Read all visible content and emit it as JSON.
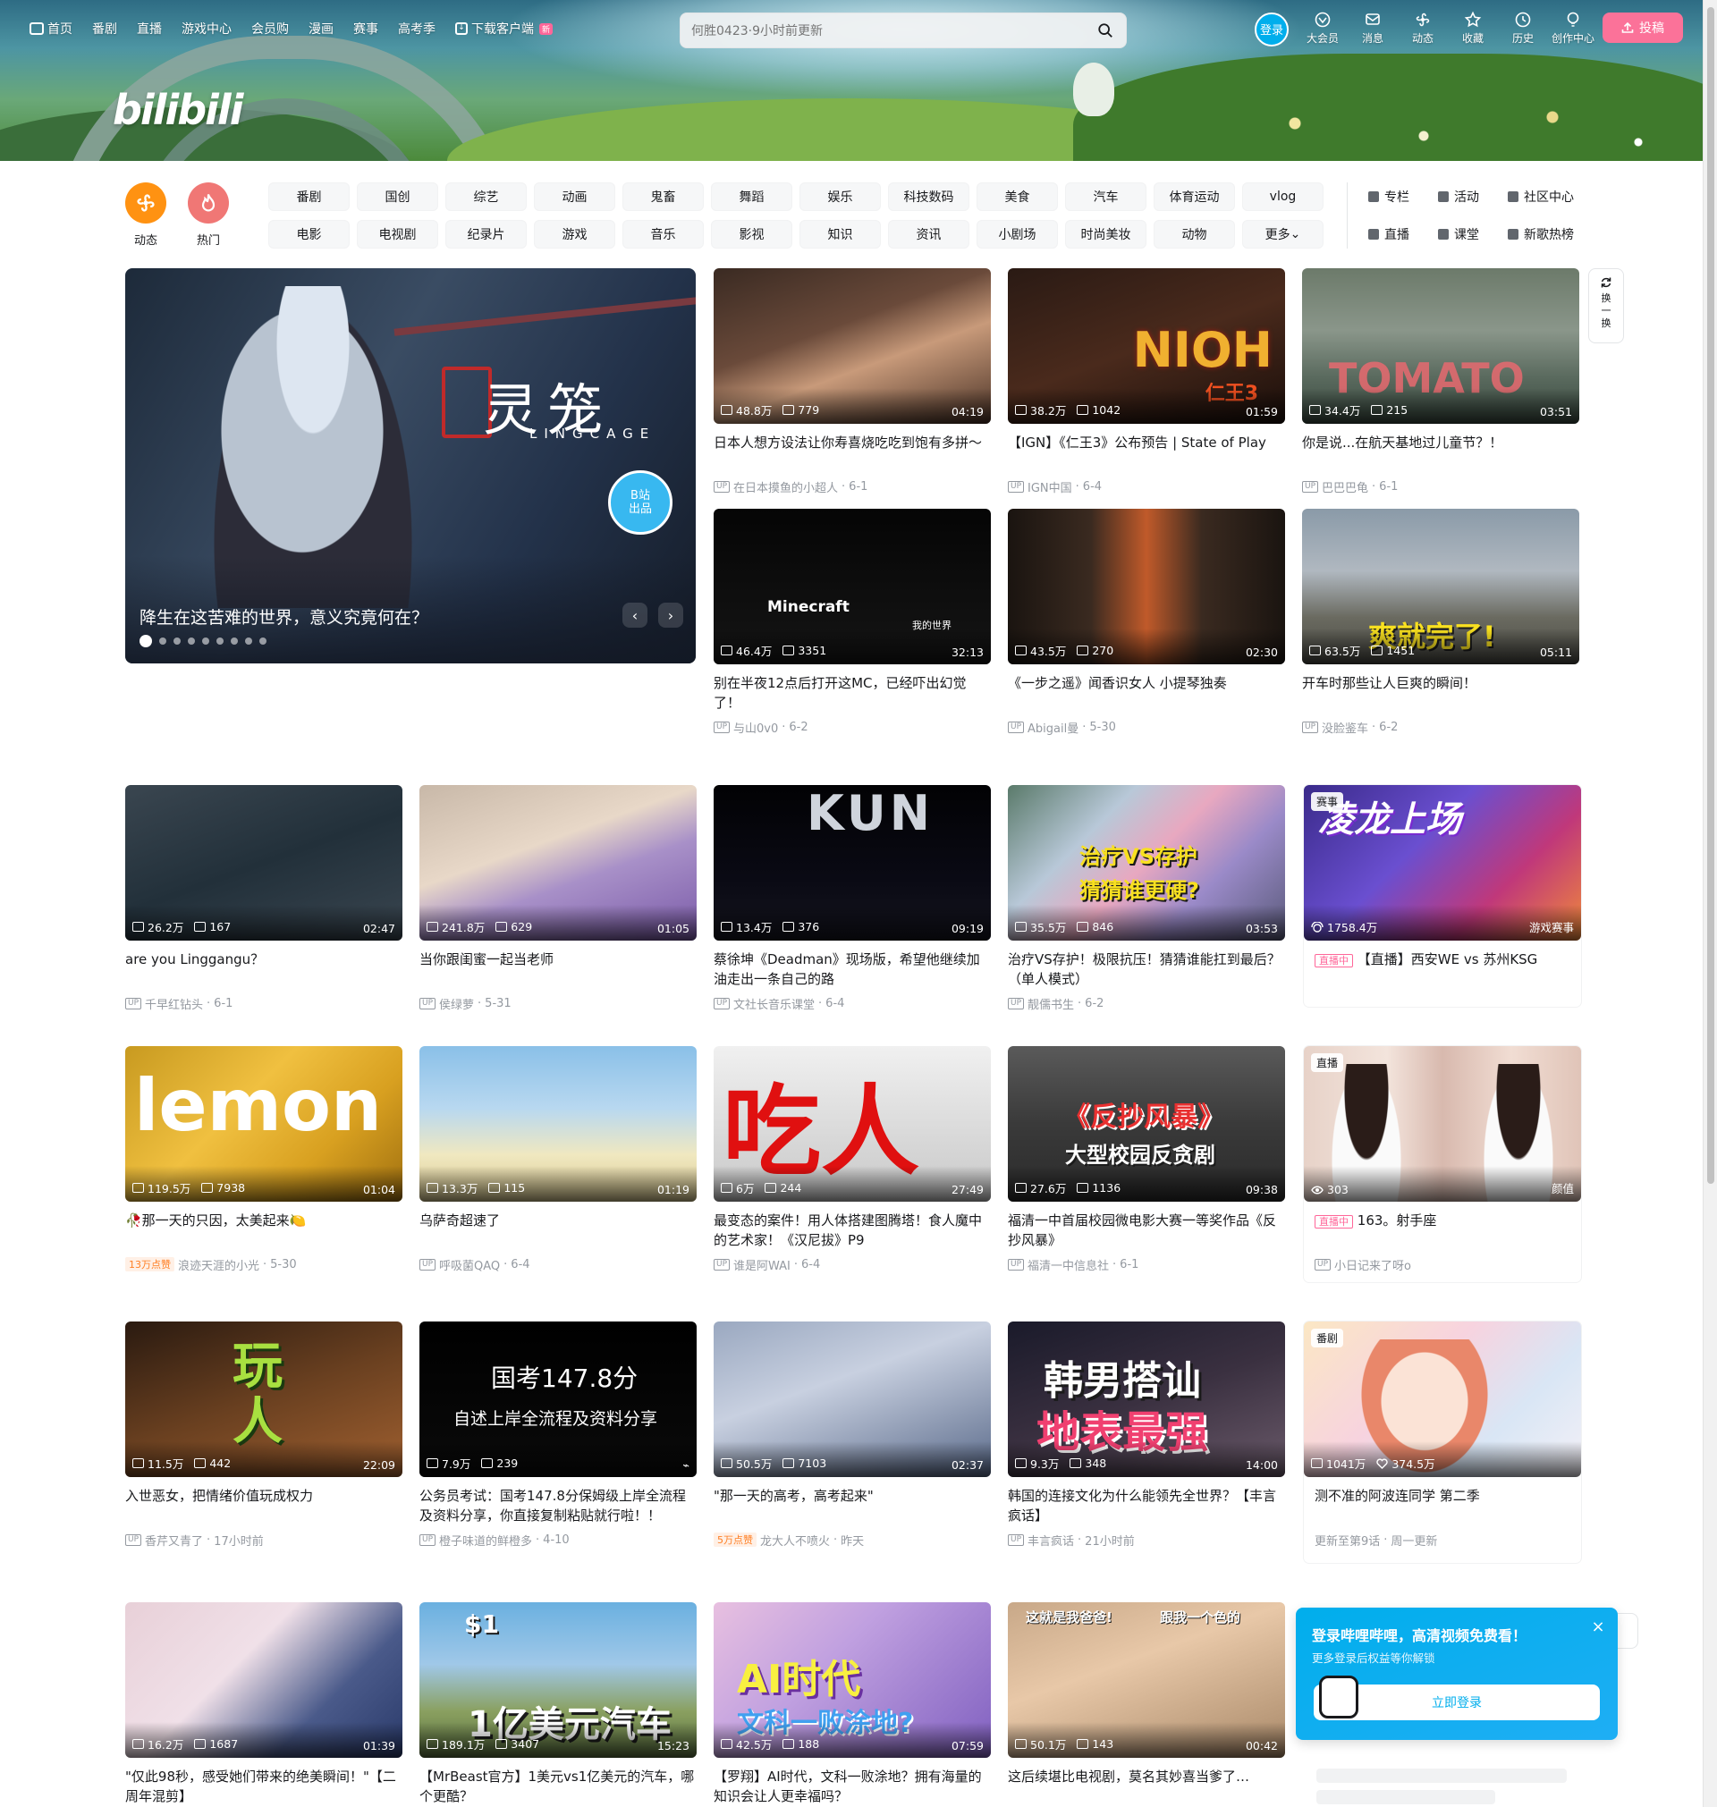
{
  "topnav": {
    "items": [
      "首页",
      "番剧",
      "直播",
      "游戏中心",
      "会员购",
      "漫画",
      "赛事",
      "高考季"
    ],
    "download": "下载客户端",
    "new_badge": "新"
  },
  "search": {
    "placeholder": "何胜0423·9小时前更新"
  },
  "user": {
    "login": "登录"
  },
  "rightnav": [
    "大会员",
    "消息",
    "动态",
    "收藏",
    "历史",
    "创作中心"
  ],
  "upload": "投稿",
  "channels": {
    "dynamic": "动态",
    "hot": "热门",
    "tags": [
      "番剧",
      "国创",
      "综艺",
      "动画",
      "鬼畜",
      "舞蹈",
      "娱乐",
      "科技数码",
      "美食",
      "汽车",
      "体育运动",
      "vlog",
      "电影",
      "电视剧",
      "纪录片",
      "游戏",
      "音乐",
      "影视",
      "知识",
      "资讯",
      "小剧场",
      "时尚美妆",
      "动物",
      "更多"
    ],
    "side": [
      "专栏",
      "活动",
      "社区中心",
      "直播",
      "课堂",
      "新歌热榜"
    ]
  },
  "carousel": {
    "title": "降生在这苦难的世界，意义究竟何在？",
    "logo_text": "灵笼",
    "logo_sub": "LINGCAGE",
    "badge_top": "B站",
    "badge_bottom": "出品",
    "prev": "‹",
    "next": "›"
  },
  "refresh": [
    "换",
    "一",
    "换"
  ],
  "cards": [
    {
      "plays": "48.8万",
      "danmaku": "779",
      "duration": "04:19",
      "title": "日本人想方设法让你寿喜烧吃吃到饱有多拼～",
      "uploader": "在日本摸鱼的小超人",
      "date": "6-1"
    },
    {
      "plays": "38.2万",
      "danmaku": "1042",
      "duration": "01:59",
      "title": "【IGN】《仁王3》公布预告 | State of Play",
      "uploader": "IGN中国",
      "date": "6-4",
      "overlay": "NIOH",
      "overlay2": "仁王3"
    },
    {
      "plays": "34.4万",
      "danmaku": "215",
      "duration": "03:51",
      "title": "你是说...在航天基地过儿童节？！",
      "uploader": "巴巴巴龟",
      "date": "6-1",
      "overlay": "TOMATO"
    },
    {
      "plays": "46.4万",
      "danmaku": "3351",
      "duration": "32:13",
      "title": "别在半夜12点后打开这MC，已经吓出幻觉了！",
      "uploader": "与山0v0",
      "date": "6-2",
      "overlay": "Minecraft",
      "overlay2": "我的世界"
    },
    {
      "plays": "43.5万",
      "danmaku": "270",
      "duration": "02:30",
      "title": "《一步之遥》闻香识女人 小提琴独奏",
      "uploader": "Abigail曼",
      "date": "5-30"
    },
    {
      "plays": "63.5万",
      "danmaku": "1451",
      "duration": "05:11",
      "title": "开车时那些让人巨爽的瞬间！",
      "uploader": "没脸鉴车",
      "date": "6-2",
      "overlay": "爽就完了!"
    },
    {
      "plays": "26.2万",
      "danmaku": "167",
      "duration": "02:47",
      "title": "are you Linggangu？",
      "uploader": "千早红钻头",
      "date": "6-1"
    },
    {
      "plays": "241.8万",
      "danmaku": "629",
      "duration": "01:05",
      "title": "当你跟闺蜜一起当老师",
      "uploader": "侯绿萝",
      "date": "5-31"
    },
    {
      "plays": "13.4万",
      "danmaku": "376",
      "duration": "09:19",
      "title": "蔡徐坤《Deadman》现场版，希望他继续加油走出一条自己的路",
      "uploader": "文社长音乐课堂",
      "date": "6-4",
      "overlay": "KUN"
    },
    {
      "plays": "35.5万",
      "danmaku": "846",
      "duration": "03:53",
      "title": "治疗VS存护！极限抗压！猜猜谁能扛到最后？（单人模式）",
      "uploader": "靓儒书生",
      "date": "6-2",
      "overlay": "治疗VS存护",
      "overlay2": "猜猜谁更硬?"
    },
    {
      "plays": "119.5万",
      "danmaku": "7938",
      "duration": "01:04",
      "title": "🥀那一天的只因，太美起来🍋",
      "uploader": "浪迹天涯的小光",
      "date": "5-30",
      "hot": "13万点赞",
      "overlay": "lemon"
    },
    {
      "plays": "13.3万",
      "danmaku": "115",
      "duration": "01:19",
      "title": "乌萨奇超速了",
      "uploader": "呼吸菌QAQ",
      "date": "6-4"
    },
    {
      "plays": "6万",
      "danmaku": "244",
      "duration": "27:49",
      "title": "最变态的案件！用人体搭建图腾塔！食人魔中的艺术家！《汉尼拔》P9",
      "uploader": "谁是阿WAI",
      "date": "6-4",
      "overlay": "吃人"
    },
    {
      "plays": "27.6万",
      "danmaku": "1136",
      "duration": "09:38",
      "title": "福清一中首届校园微电影大赛一等奖作品《反抄风暴》",
      "uploader": "福清一中信息社",
      "date": "6-1",
      "overlay": "《反抄风暴》",
      "overlay2": "大型校园反贪剧"
    },
    {
      "plays": "11.5万",
      "danmaku": "442",
      "duration": "22:09",
      "title": "入世恶女，把情绪价值玩成权力",
      "uploader": "香芹又青了",
      "date": "17小时前",
      "overlay": "玩人"
    },
    {
      "plays": "7.9万",
      "danmaku": "239",
      "duration": "",
      "title": "公务员考试：国考147.8分保姆级上岸全流程及资料分享，你直接复制粘贴就行啦！！",
      "uploader": "橙子味道的鲜橙多",
      "date": "4-10",
      "overlay": "国考147.8分",
      "overlay2": "自述上岸全流程及资料分享"
    },
    {
      "plays": "50.5万",
      "danmaku": "7103",
      "duration": "02:37",
      "title": "\"那一天的高考，高考起来\"",
      "uploader": "龙大人不喷火",
      "date": "昨天",
      "hot": "5万点赞"
    },
    {
      "plays": "9.3万",
      "danmaku": "348",
      "duration": "14:00",
      "title": "韩国的连接文化为什么能领先全世界？【丰言疯话】",
      "uploader": "丰言疯话",
      "date": "21小时前",
      "overlay": "韩男搭讪",
      "overlay2": "地表最强"
    },
    {
      "plays": "16.2万",
      "danmaku": "1687",
      "duration": "01:39",
      "title": "\"仅此98秒，感受她们带来的绝美瞬间！\"【二周年混剪】",
      "uploader": "",
      "date": ""
    },
    {
      "plays": "189.1万",
      "danmaku": "3407",
      "duration": "15:23",
      "title": "【MrBeast官方】1美元vs1亿美元的汽车，哪个更酷？",
      "uploader": "",
      "date": "",
      "overlay": "1亿美元汽车",
      "overlay2": "$1"
    },
    {
      "plays": "42.5万",
      "danmaku": "188",
      "duration": "07:59",
      "title": "【罗翔】AI时代，文科一败涂地？拥有海量的知识会让人更幸福吗？",
      "uploader": "",
      "date": "",
      "overlay": "AI时代",
      "overlay2": "文科一败涂地?"
    },
    {
      "plays": "50.1万",
      "danmaku": "143",
      "duration": "00:42",
      "title": "这后续堪比电视剧，莫名其妙喜当爹了…",
      "uploader": "",
      "date": "",
      "overlay": "这就是我爸爸!",
      "overlay2": "跟我一个色的"
    }
  ],
  "live1": {
    "viewers": "1758.4万",
    "category": "游戏赛事",
    "badge": "赛事",
    "live_tag": "直播中",
    "title": "【直播】西安WE vs 苏州KSG",
    "overlay": "凌龙上场"
  },
  "live2": {
    "viewers": "303",
    "category": "颜值",
    "badge": "直播",
    "live_tag": "直播中",
    "title": "163。射手座",
    "uploader": "小日记来了呀o"
  },
  "bangumi": {
    "badge": "番剧",
    "plays": "1041万",
    "likes": "374.5万",
    "title": "测不准的阿波连同学 第二季",
    "update": "更新至第9话",
    "weekday": "周一更新"
  },
  "popup": {
    "heading": "登录哔哩哔哩，高清视频免费看！",
    "sub": "更多登录后权益等你解锁",
    "button": "立即登录",
    "close": "×"
  },
  "logo": "bilibili",
  "colors": {
    "brand_pink": "#fb7299",
    "brand_blue": "#00aeec",
    "hot_orange": "#ff7f24"
  }
}
